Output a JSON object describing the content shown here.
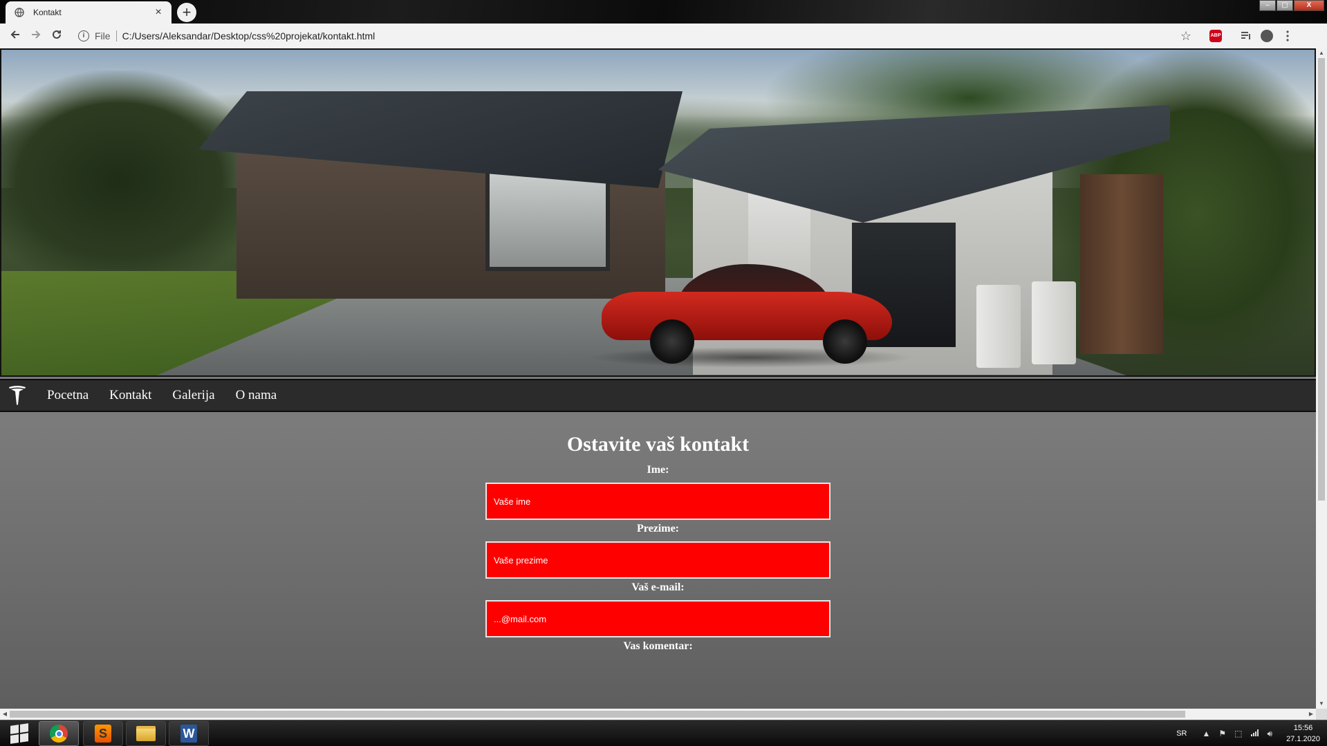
{
  "browser": {
    "tab_title": "Kontakt",
    "tab_close": "×",
    "new_tab": "+",
    "window_controls": [
      "–",
      "▢",
      "X"
    ],
    "address_scheme": "File",
    "address_url": "C:/Users/Aleksandar/Desktop/css%20projekat/kontakt.html",
    "abp_label": "ABP",
    "icons": {
      "back": "arrow-left",
      "forward": "arrow-right",
      "reload": "reload",
      "info": "info",
      "bookmark": "star",
      "extension": "adblock-plus",
      "media": "media-queue",
      "profile": "account",
      "menu": "kebab"
    }
  },
  "site": {
    "nav": {
      "logo": "tesla-logo",
      "items": [
        "Pocetna",
        "Kontakt",
        "Galerija",
        "O nama"
      ]
    },
    "form": {
      "heading": "Ostavite vaš kontakt",
      "fields": [
        {
          "label": "Ime:",
          "placeholder": "Vaše ime"
        },
        {
          "label": "Prezime:",
          "placeholder": "Vaše prezime"
        },
        {
          "label": "Vaš e-mail:",
          "placeholder": "...@mail.com"
        },
        {
          "label": "Vas komentar:"
        }
      ],
      "input_color": "#ff0000"
    }
  },
  "taskbar": {
    "apps": [
      "chrome",
      "sublime-text",
      "file-explorer",
      "word"
    ],
    "language": "SR",
    "time": "15:56",
    "date": "27.1.2020"
  }
}
